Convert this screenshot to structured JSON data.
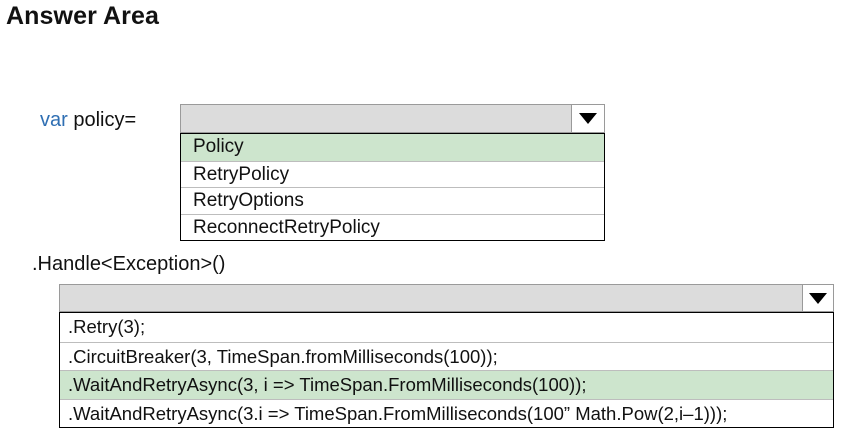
{
  "title": "Answer Area",
  "code": {
    "var_keyword": "var",
    "var_rest": " policy=",
    "handle_line": ".Handle<Exception>()"
  },
  "dropdown1": {
    "arrow_icon": "triangle-down",
    "options": [
      "Policy",
      "RetryPolicy",
      "RetryOptions",
      "ReconnectRetryPolicy"
    ],
    "selected": "Policy",
    "highlight_color": "#cde5cd"
  },
  "dropdown2": {
    "arrow_icon": "triangle-down",
    "options": [
      ".Retry(3);",
      ".CircuitBreaker(3, TimeSpan.fromMilliseconds(100));",
      ".WaitAndRetryAsync(3, i => TimeSpan.FromMilliseconds(100));",
      ".WaitAndRetryAsync(3.i => TimeSpan.FromMilliseconds(100” Math.Pow(2,i–1)));"
    ],
    "selected": ".WaitAndRetryAsync(3, i => TimeSpan.FromMilliseconds(100));",
    "highlight_color": "#cde5cd"
  },
  "colors": {
    "keyword": "#2f6fb3",
    "dropdown_header": "#dcdcdc"
  }
}
